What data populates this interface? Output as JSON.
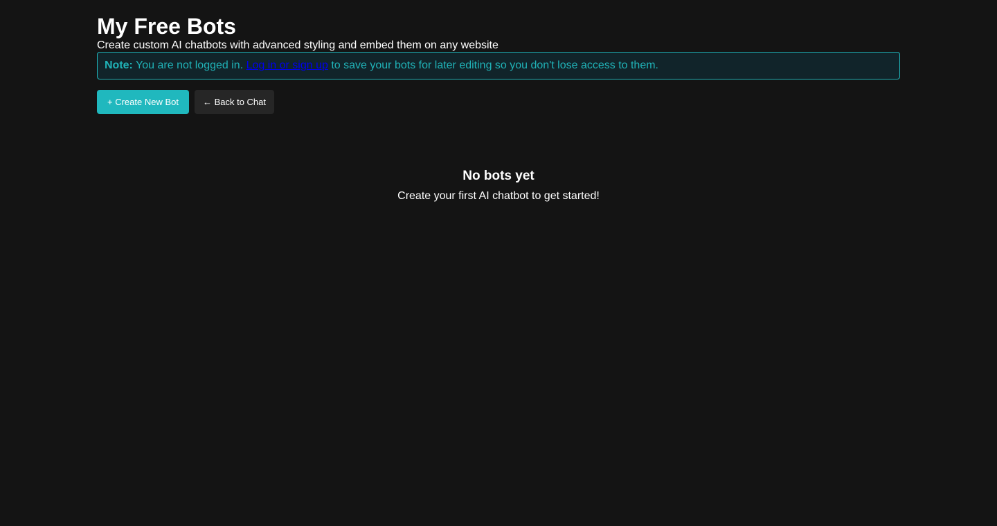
{
  "header": {
    "title": "My Free Bots",
    "subtitle": "Create custom AI chatbots with advanced styling and embed them on any website"
  },
  "notice": {
    "label": "Note:",
    "text_before": " You are not logged in. ",
    "link_text": "Log in or sign up",
    "text_after": " to save your bots for later editing so you don't lose access to them.",
    "accent_color": "#20b3b8",
    "link_color": "#0000ee"
  },
  "toolbar": {
    "create_label": "+ Create New Bot",
    "back_label": "← Back to Chat",
    "primary_color": "#20b8be"
  },
  "empty_state": {
    "title": "No bots yet",
    "text": "Create your first AI chatbot to get started!"
  }
}
